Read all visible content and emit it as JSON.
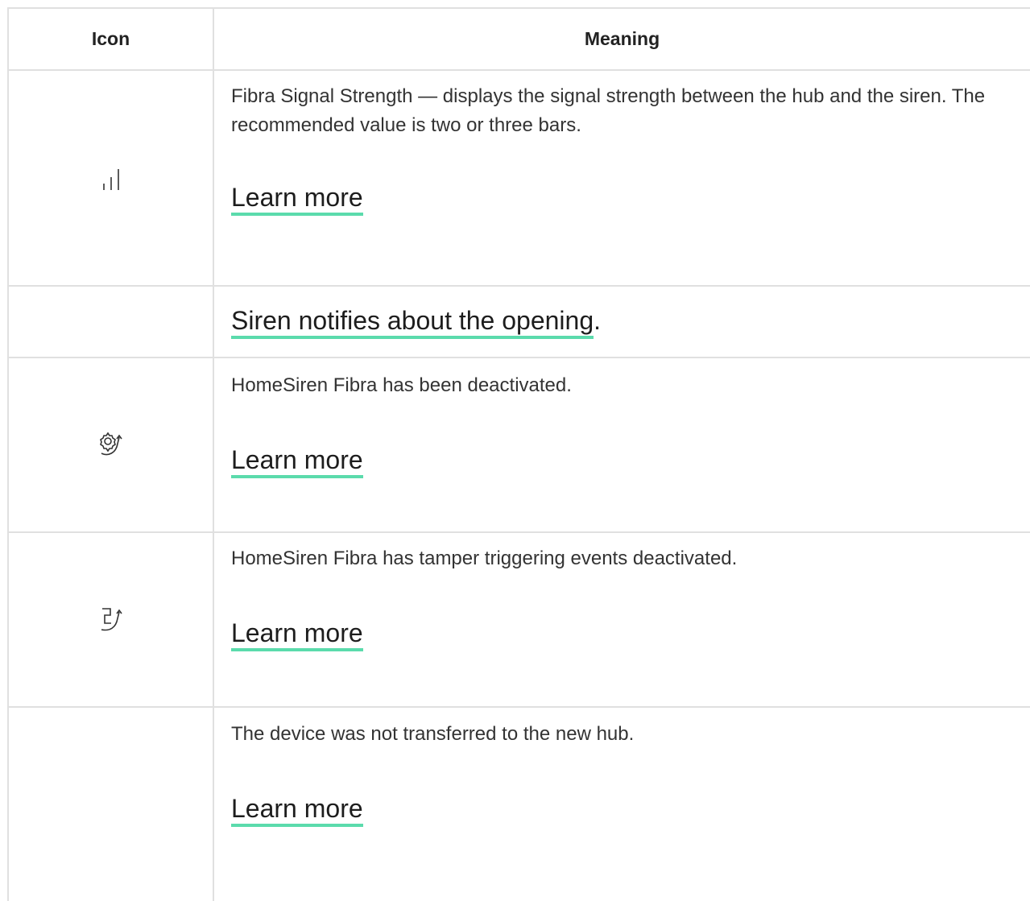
{
  "header": {
    "icon_col": "Icon",
    "meaning_col": "Meaning"
  },
  "rows": [
    {
      "icon": "signal-strength-icon",
      "description": "Fibra Signal Strength — displays the signal strength between the hub and the siren. The recommended value is two or three bars.",
      "link": "Learn more"
    },
    {
      "icon": "",
      "link": "Siren notifies about the opening",
      "suffix": "."
    },
    {
      "icon": "gear-deactivated-icon",
      "description": "HomeSiren Fibra has been deactivated.",
      "link": "Learn more"
    },
    {
      "icon": "tamper-deactivated-icon",
      "description": "HomeSiren Fibra has tamper triggering events deactivated.",
      "link": "Learn more"
    },
    {
      "icon": "",
      "description": "The device was not transferred to the new hub.",
      "link": "Learn more"
    }
  ],
  "colors": {
    "border": "#e0e0e0",
    "link_underline": "#5bdbac",
    "text": "#333333"
  }
}
